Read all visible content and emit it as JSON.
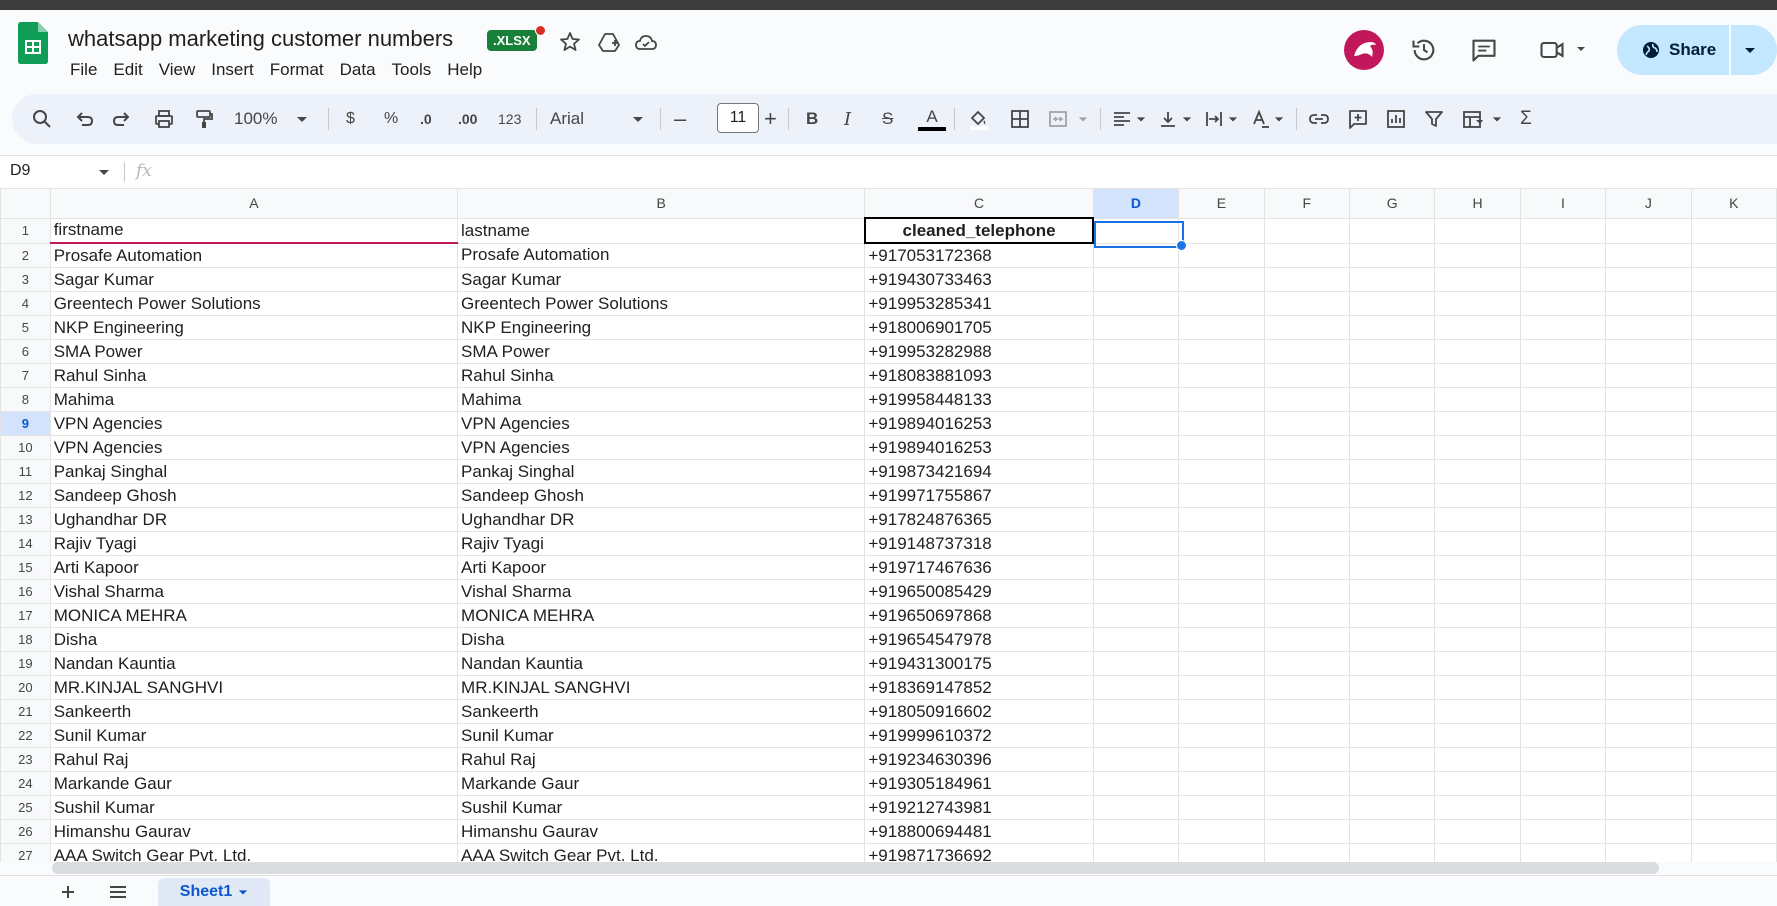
{
  "doc": {
    "title": "whatsapp marketing customer numbers",
    "badge": ".XLSX"
  },
  "menu": [
    "File",
    "Edit",
    "View",
    "Insert",
    "Format",
    "Data",
    "Tools",
    "Help"
  ],
  "share_label": "Share",
  "toolbar": {
    "zoom": "100%",
    "currency": "$",
    "percent": "%",
    "dec_decrease": ".0",
    "dec_increase": ".00",
    "number_format": "123",
    "font": "Arial",
    "font_size": "11",
    "minus": "–",
    "plus": "+",
    "bold": "B",
    "italic": "I",
    "strike": "S",
    "text_color_glyph": "A",
    "sum": "Σ"
  },
  "formula_bar": {
    "cell_ref": "D9",
    "fx": "fx"
  },
  "columns": [
    "A",
    "B",
    "C",
    "D",
    "E",
    "F",
    "G",
    "H",
    "I",
    "J",
    "K"
  ],
  "selected": {
    "column": "D",
    "row": 9
  },
  "rows": [
    [
      "firstname",
      "lastname",
      "cleaned_telephone"
    ],
    [
      "Prosafe Automation",
      "Prosafe Automation",
      "+917053172368"
    ],
    [
      "Sagar Kumar",
      "Sagar Kumar",
      "+919430733463"
    ],
    [
      "Greentech Power Solutions",
      "Greentech Power Solutions",
      "+919953285341"
    ],
    [
      "NKP Engineering",
      "NKP Engineering",
      "+918006901705"
    ],
    [
      "SMA Power",
      "SMA Power",
      "+919953282988"
    ],
    [
      "Rahul Sinha",
      "Rahul Sinha",
      "+918083881093"
    ],
    [
      "Mahima",
      "Mahima",
      "+919958448133"
    ],
    [
      "VPN  Agencies",
      "VPN  Agencies",
      "+919894016253"
    ],
    [
      "VPN  Agencies",
      "VPN  Agencies",
      "+919894016253"
    ],
    [
      "Pankaj Singhal",
      "Pankaj Singhal",
      "+919873421694"
    ],
    [
      "Sandeep Ghosh",
      "Sandeep Ghosh",
      "+919971755867"
    ],
    [
      "Ughandhar DR",
      "Ughandhar DR",
      "+917824876365"
    ],
    [
      "Rajiv Tyagi",
      "Rajiv Tyagi",
      "+919148737318"
    ],
    [
      "Arti Kapoor",
      "Arti Kapoor",
      "+919717467636"
    ],
    [
      "Vishal Sharma",
      "Vishal Sharma",
      "+919650085429"
    ],
    [
      "MONICA MEHRA",
      "MONICA MEHRA",
      "+919650697868"
    ],
    [
      "Disha",
      "Disha",
      "+919654547978"
    ],
    [
      "Nandan Kauntia",
      "Nandan Kauntia",
      "+919431300175"
    ],
    [
      "MR.KINJAL SANGHVI",
      "MR.KINJAL SANGHVI",
      "+918369147852"
    ],
    [
      "Sankeerth",
      "Sankeerth",
      "+918050916602"
    ],
    [
      "Sunil Kumar",
      "Sunil Kumar",
      "+919999610372"
    ],
    [
      "Rahul Raj",
      "Rahul Raj",
      "+919234630396"
    ],
    [
      "Markande Gaur",
      "Markande Gaur",
      "+919305184961"
    ],
    [
      "Sushil  Kumar",
      "Sushil  Kumar",
      "+919212743981"
    ],
    [
      "Himanshu Gaurav",
      "Himanshu Gaurav",
      "+918800694481"
    ],
    [
      "AAA Switch Gear Pvt. Ltd.",
      "AAA Switch Gear Pvt. Ltd.",
      "+919871736692"
    ]
  ],
  "sheet_tab": "Sheet1",
  "colors": {
    "accent": "#1a73e8",
    "sheets_green": "#188038",
    "share_bg": "#c2e7ff",
    "avatar": "#c2185b"
  }
}
